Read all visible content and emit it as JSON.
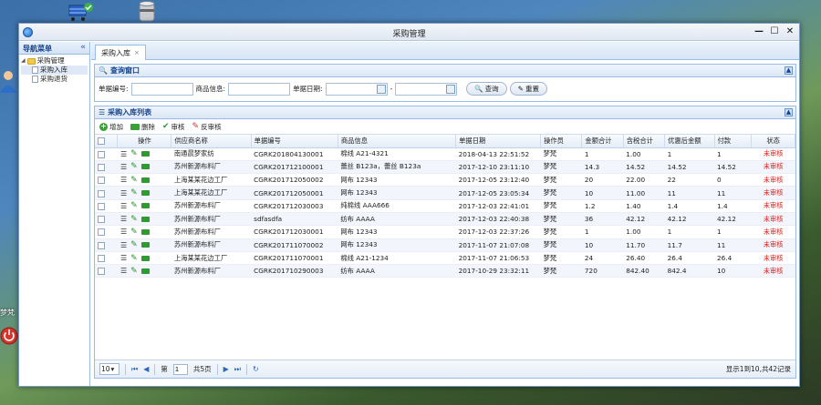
{
  "desktop": {
    "user_label": "梦梵"
  },
  "window": {
    "title": "采购管理"
  },
  "nav": {
    "title": "导航菜单",
    "collapse": "«",
    "root": "采购管理",
    "items": [
      {
        "label": "采购入库"
      },
      {
        "label": "采购退货"
      }
    ]
  },
  "tab": {
    "label": "采购入库",
    "close": "×"
  },
  "search": {
    "title": "查询窗口",
    "order_no_label": "单据编号:",
    "product_label": "商品信息:",
    "date_label": "单据日期:",
    "date_sep": "-",
    "query_button": "查询",
    "reset_button": "重置"
  },
  "list": {
    "title": "采购入库列表",
    "toolbar": {
      "add": "增加",
      "delete": "删除",
      "audit": "审核",
      "unaudit": "反审核"
    },
    "columns": [
      "",
      "操作",
      "供应商名称",
      "单据编号",
      "商品信息",
      "单据日期",
      "操作员",
      "金额合计",
      "含税合计",
      "优惠后金额",
      "付款",
      "状态"
    ],
    "rows": [
      {
        "supplier": "南通晨梦家纺",
        "no": "CGRK201804130001",
        "product": "棉线 A21-4321",
        "date": "2018-04-13 22:51:52",
        "operator": "梦梵",
        "amount": "1",
        "tax_total": "1.00",
        "discounted": "1",
        "paid": "1",
        "status": "未审核"
      },
      {
        "supplier": "苏州新源布料厂",
        "no": "CGRK201712100001",
        "product": "蕾丝 B123a，蕾丝 B123a",
        "date": "2017-12-10 23:11:10",
        "operator": "梦梵",
        "amount": "14.3",
        "tax_total": "14.52",
        "discounted": "14.52",
        "paid": "14.52",
        "status": "未审核"
      },
      {
        "supplier": "上海某某花边工厂",
        "no": "CGRK201712050002",
        "product": "网布 12343",
        "date": "2017-12-05 23:12:40",
        "operator": "梦梵",
        "amount": "20",
        "tax_total": "22.00",
        "discounted": "22",
        "paid": "0",
        "status": "未审核"
      },
      {
        "supplier": "上海某某花边工厂",
        "no": "CGRK201712050001",
        "product": "网布 12343",
        "date": "2017-12-05 23:05:34",
        "operator": "梦梵",
        "amount": "10",
        "tax_total": "11.00",
        "discounted": "11",
        "paid": "11",
        "status": "未审核"
      },
      {
        "supplier": "苏州新源布料厂",
        "no": "CGRK201712030003",
        "product": "纯棉线 AAA666",
        "date": "2017-12-03 22:41:01",
        "operator": "梦梵",
        "amount": "1.2",
        "tax_total": "1.40",
        "discounted": "1.4",
        "paid": "1.4",
        "status": "未审核"
      },
      {
        "supplier": "苏州新源布料厂",
        "no": "sdfasdfa",
        "product": "纺布 AAAA",
        "date": "2017-12-03 22:40:38",
        "operator": "梦梵",
        "amount": "36",
        "tax_total": "42.12",
        "discounted": "42.12",
        "paid": "42.12",
        "status": "未审核"
      },
      {
        "supplier": "苏州新源布料厂",
        "no": "CGRK201712030001",
        "product": "网布 12343",
        "date": "2017-12-03 22:37:26",
        "operator": "梦梵",
        "amount": "1",
        "tax_total": "1.00",
        "discounted": "1",
        "paid": "1",
        "status": "未审核"
      },
      {
        "supplier": "苏州新源布料厂",
        "no": "CGRK201711070002",
        "product": "网布 12343",
        "date": "2017-11-07 21:07:08",
        "operator": "梦梵",
        "amount": "10",
        "tax_total": "11.70",
        "discounted": "11.7",
        "paid": "11",
        "status": "未审核"
      },
      {
        "supplier": "上海某某花边工厂",
        "no": "CGRK201711070001",
        "product": "棉线 A21-1234",
        "date": "2017-11-07 21:06:53",
        "operator": "梦梵",
        "amount": "24",
        "tax_total": "26.40",
        "discounted": "26.4",
        "paid": "26.4",
        "status": "未审核"
      },
      {
        "supplier": "苏州新源布料厂",
        "no": "CGRK201710290003",
        "product": "纺布 AAAA",
        "date": "2017-10-29 23:32:11",
        "operator": "梦梵",
        "amount": "720",
        "tax_total": "842.40",
        "discounted": "842.4",
        "paid": "10",
        "status": "未审核"
      }
    ]
  },
  "pager": {
    "page_size": "10",
    "page_prefix": "第",
    "page_value": "1",
    "page_suffix": "共5页",
    "info": "显示1到10,共42记录"
  },
  "colors": {
    "status_unaudited": "#e0201b",
    "header_blue": "#15428b",
    "border_blue": "#99bbe8"
  }
}
